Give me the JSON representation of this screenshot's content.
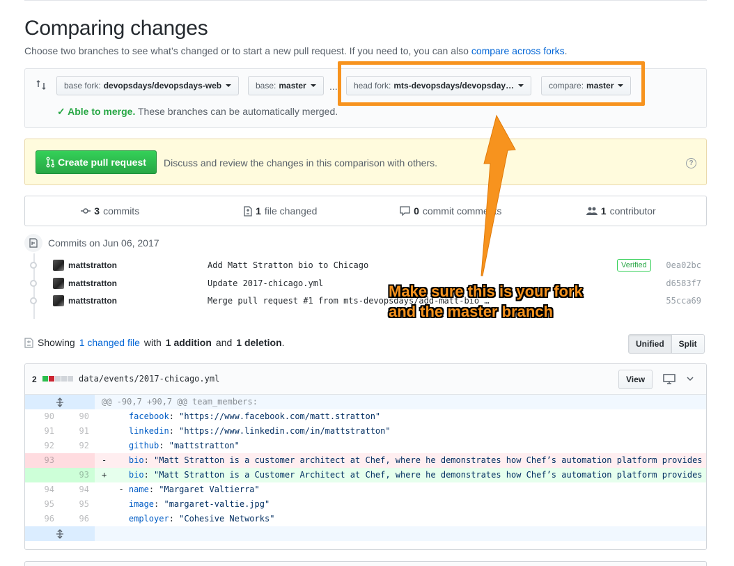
{
  "page": {
    "title": "Comparing changes",
    "subtitle": "Choose two branches to see what’s changed or to start a new pull request. If you need to, you can also",
    "subtitle_link": "compare across forks",
    "subtitle_end": "."
  },
  "range": {
    "base_fork_label": "base fork:",
    "base_fork_value": "devopsdays/devopsdays-web",
    "base_label": "base:",
    "base_value": "master",
    "separator": "...",
    "head_fork_label": "head fork:",
    "head_fork_value": "mts-devopsdays/devopsday…",
    "compare_label": "compare:",
    "compare_value": "master",
    "merge_status": "✓ Able to merge.",
    "merge_text": "These branches can be automatically merged."
  },
  "pull_request": {
    "button_label": "Create pull request",
    "description": "Discuss and review the changes in this comparison with others.",
    "help_glyph": "?"
  },
  "stats": {
    "commits_count": "3",
    "commits_label": "commits",
    "files_count": "1",
    "files_label": "file changed",
    "comments_count": "0",
    "comments_label": "commit comments",
    "contributors_count": "1",
    "contributors_label": "contributor"
  },
  "commits": {
    "heading": "Commits on Jun 06, 2017",
    "items": [
      {
        "author": "mattstratton",
        "message": "Add Matt Stratton bio to Chicago",
        "verified": "Verified",
        "sha": "0ea02bc"
      },
      {
        "author": "mattstratton",
        "message": "Update 2017-chicago.yml",
        "sha": "d6583f7"
      },
      {
        "author": "mattstratton",
        "message": "Merge pull request #1 from mts-devopsdays/add-matt-bio",
        "ellipsis": "…",
        "sha": "55cca69"
      }
    ]
  },
  "annotation": {
    "line1": "Make sure this is your fork",
    "line2": "and the master branch",
    "color": "#f7931e"
  },
  "files": {
    "showing": "Showing",
    "changed_link": "1 changed file",
    "with": "with",
    "additions": "1 addition",
    "and": "and",
    "deletions": "1 deletion",
    "end": ".",
    "unified_label": "Unified",
    "split_label": "Split"
  },
  "file": {
    "change_count": "2",
    "path": "data/events/2017-chicago.yml",
    "view_label": "View",
    "hunk_header": "@@ -90,7 +90,7 @@ team_members:",
    "lines": [
      {
        "old": "90",
        "new": "90",
        "sign": "",
        "key": "facebook",
        "value": "\"https://www.facebook.com/matt.stratton\"",
        "indent": "    "
      },
      {
        "old": "91",
        "new": "91",
        "sign": "",
        "key": "linkedin",
        "value": "\"https://www.linkedin.com/in/mattstratton\"",
        "indent": "    "
      },
      {
        "old": "92",
        "new": "92",
        "sign": "",
        "key": "github",
        "value": "\"mattstratton\"",
        "indent": "    "
      },
      {
        "old": "93",
        "new": "",
        "sign": "-",
        "key": "bio",
        "value": "\"Matt Stratton is a customer architect at Chef, where he demonstrates how Chef’s automation platform provides",
        "indent": "    "
      },
      {
        "old": "",
        "new": "93",
        "sign": "+",
        "key": "bio",
        "value": "\"Matt Stratton is a Customer Architect at Chef, where he demonstrates how Chef’s automation platform provides",
        "indent": "    "
      },
      {
        "old": "94",
        "new": "94",
        "sign": "",
        "key": "name",
        "value": "\"Margaret Valtierra\"",
        "indent": "  - "
      },
      {
        "old": "95",
        "new": "95",
        "sign": "",
        "key": "image",
        "value": "\"margaret-valtie.jpg\"",
        "indent": "    "
      },
      {
        "old": "96",
        "new": "96",
        "sign": "",
        "key": "employer",
        "value": "\"Cohesive Networks\"",
        "indent": "    "
      }
    ]
  }
}
